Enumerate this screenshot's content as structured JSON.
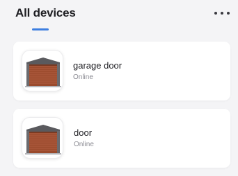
{
  "header": {
    "title": "All devices",
    "accent_color": "#3d7ee0",
    "more_icon": "more-horizontal-icon"
  },
  "devices": [
    {
      "name": "garage door",
      "status": "Online",
      "icon": "garage-door-icon"
    },
    {
      "name": "door",
      "status": "Online",
      "icon": "garage-door-icon"
    }
  ],
  "colors": {
    "background": "#f4f4f6",
    "card": "#ffffff",
    "status_text": "#8b8b93",
    "door_panel": "#9a4a2c"
  }
}
